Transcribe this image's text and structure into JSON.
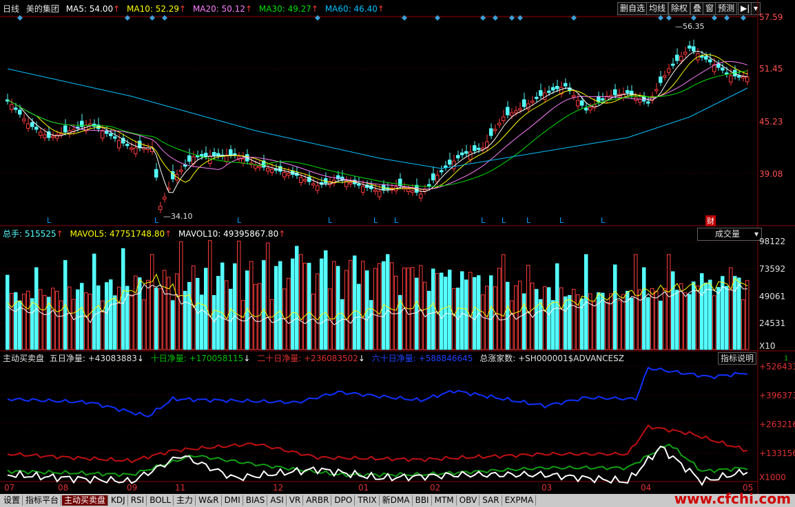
{
  "header": {
    "period": "日线",
    "stock": "美的集团",
    "ma5": "MA5: 54.00",
    "ma10": "MA10: 52.29",
    "ma20": "MA20: 50.12",
    "ma30": "MA30: 49.27",
    "ma60": "MA60: 46.40"
  },
  "toolbar": [
    "删自选",
    "均线",
    "除权",
    "叠",
    "窗",
    "预测"
  ],
  "price_axis": [
    "57.59",
    "51.45",
    "45.23",
    "39.08"
  ],
  "price_labels": {
    "high": "56.35",
    "low": "34.10",
    "cai": "财"
  },
  "vol_header": {
    "total": "总手: 515525",
    "mavol5": "MAVOL5: 47751748.80",
    "mavol10": "MAVOL10: 49395867.80",
    "select": "成交量"
  },
  "vol_axis": [
    "98122",
    "73592",
    "49061",
    "24531",
    "X10"
  ],
  "ind_header": {
    "name": "主动买卖盘",
    "n5": "五日净量: +43083883",
    "n10": "十日净量: +170058115",
    "n20": "二十日净量: +236083502",
    "n60": "六十日净量: +588846645",
    "adv": "总涨家数: +SH000001$ADVANCESZ",
    "help": "指标说明",
    "scale_mark": "1"
  },
  "ind_axis": [
    "+526433",
    "+396373",
    "+263216",
    "+133156",
    "X1000"
  ],
  "date_axis": [
    "07",
    "08",
    "09",
    "11",
    "12",
    "01",
    "02",
    "03",
    "04",
    "05"
  ],
  "tabs": [
    "设置",
    "指标平台",
    "主动买卖盘",
    "KDJ",
    "RSI",
    "BOLL",
    "主力",
    "W&R",
    "DMI",
    "BIAS",
    "ASI",
    "VR",
    "ARBR",
    "DPO",
    "TRIX",
    "新DMA",
    "BBI",
    "MTM",
    "OBV",
    "SAR",
    "EXPMA"
  ],
  "active_tab": "主动买卖盘",
  "watermark": "www.cfchi.com",
  "colors": {
    "up": "#ff3c3c",
    "down": "#54ffff",
    "ma5": "#ffffff",
    "ma10": "#ffff00",
    "ma20": "#ff80ff",
    "ma30": "#00e000",
    "ma60": "#00c0ff"
  }
}
